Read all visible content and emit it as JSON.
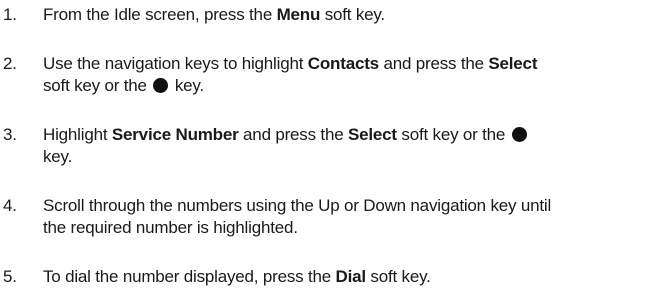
{
  "steps": [
    {
      "number": "1.",
      "parts": [
        "From the Idle screen, press the ",
        "Menu",
        " soft key."
      ]
    },
    {
      "number": "2.",
      "line1": [
        "Use the navigation keys to highlight ",
        "Contacts",
        " and press the ",
        "Select"
      ],
      "line2": [
        "soft key or the ",
        " key."
      ],
      "icon": "select-key-dot-icon"
    },
    {
      "number": "3.",
      "line1": [
        "Highlight ",
        "Service Number",
        " and press the ",
        "Select",
        " soft key or the "
      ],
      "line2": [
        "key."
      ],
      "icon": "select-key-dot-icon"
    },
    {
      "number": "4.",
      "line1": [
        "Scroll through the numbers using the Up or Down navigation key until"
      ],
      "line2": [
        "the required number is highlighted."
      ]
    },
    {
      "number": "5.",
      "parts": [
        "To dial the number displayed, press the ",
        "Dial",
        " soft key."
      ]
    }
  ]
}
